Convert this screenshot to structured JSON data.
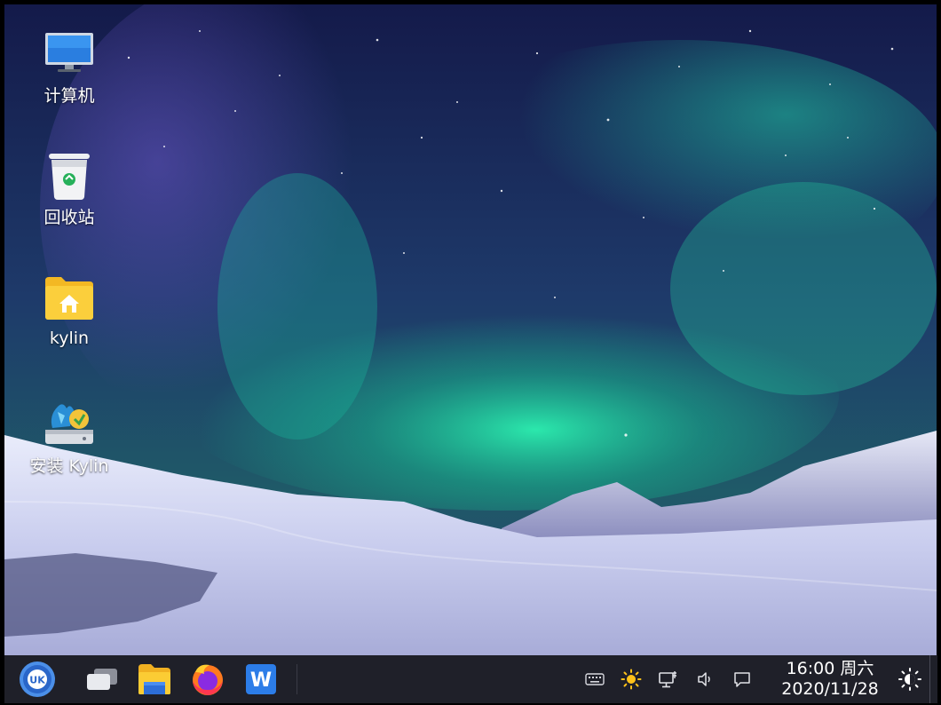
{
  "desktop": {
    "icons": [
      {
        "label": "计算机",
        "icon": "computer-icon"
      },
      {
        "label": "回收站",
        "icon": "trash-icon"
      },
      {
        "label": "kylin",
        "icon": "home-folder-icon"
      },
      {
        "label": "安装 Kylin",
        "icon": "installer-icon"
      }
    ]
  },
  "taskbar": {
    "start": {
      "icon": "start-menu-icon",
      "text": "UK"
    },
    "apps": [
      {
        "icon": "multitask-view-icon"
      },
      {
        "icon": "file-manager-icon"
      },
      {
        "icon": "firefox-icon"
      },
      {
        "icon": "wps-writer-icon",
        "text": "W"
      }
    ],
    "tray": [
      {
        "icon": "keyboard-icon"
      },
      {
        "icon": "brightness-icon"
      },
      {
        "icon": "network-icon"
      },
      {
        "icon": "volume-icon"
      },
      {
        "icon": "notification-icon"
      }
    ],
    "clock": {
      "time": "16:00 周六",
      "date": "2020/11/28"
    },
    "night_mode": {
      "icon": "night-mode-icon"
    }
  },
  "colors": {
    "taskbar_bg": "#1f2029",
    "accent": "#2f6fd6",
    "aurora": "#1fd9a0"
  }
}
